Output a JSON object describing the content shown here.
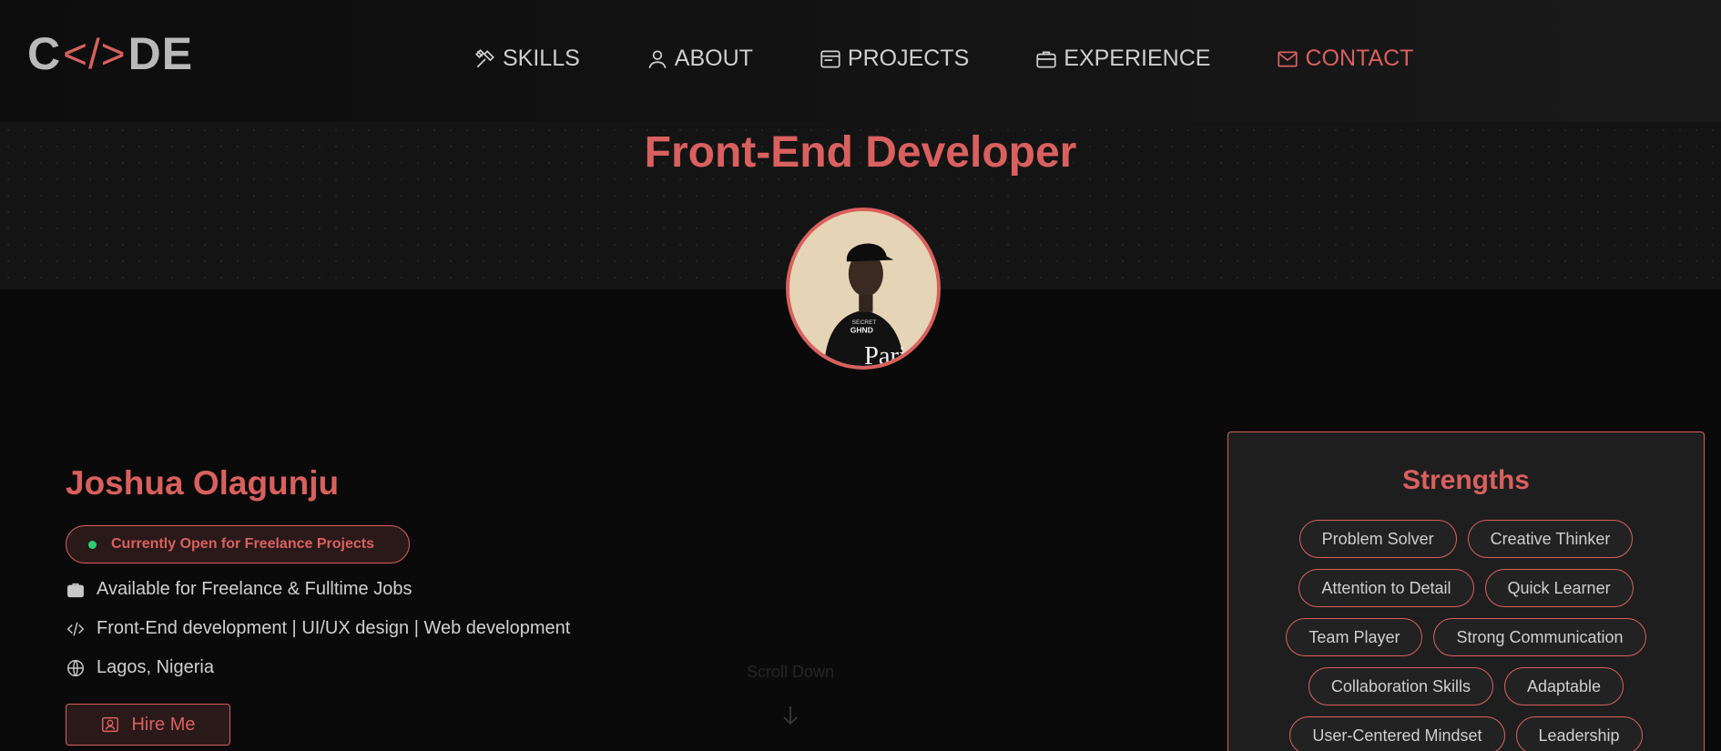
{
  "logo": {
    "left": "C",
    "symbol": "</>",
    "right": "DE"
  },
  "nav": {
    "items": [
      {
        "label": "SKILLS",
        "icon": "tools-icon"
      },
      {
        "label": "ABOUT",
        "icon": "user-icon"
      },
      {
        "label": "PROJECTS",
        "icon": "browser-icon"
      },
      {
        "label": "EXPERIENCE",
        "icon": "briefcase-icon"
      },
      {
        "label": "CONTACT",
        "icon": "envelope-icon",
        "active": true
      }
    ]
  },
  "hero": {
    "title": "Front-End Developer"
  },
  "profile": {
    "name": "Joshua Olagunju",
    "status": "Currently Open for Freelance Projects",
    "availability": "Available for Freelance & Fulltime Jobs",
    "specialties": "Front-End development | UI/UX design | Web development",
    "location": "Lagos, Nigeria",
    "hire_label": "Hire Me"
  },
  "scroll": {
    "label": "Scroll Down"
  },
  "strengths": {
    "title": "Strengths",
    "tags": [
      "Problem Solver",
      "Creative Thinker",
      "Attention to Detail",
      "Quick Learner",
      "Team Player",
      "Strong Communication",
      "Collaboration Skills",
      "Adaptable",
      "User-Centered Mindset",
      "Leadership"
    ]
  },
  "colors": {
    "accent": "#d9605e",
    "background": "#0a0a0a",
    "status_dot": "#2ecc71"
  }
}
